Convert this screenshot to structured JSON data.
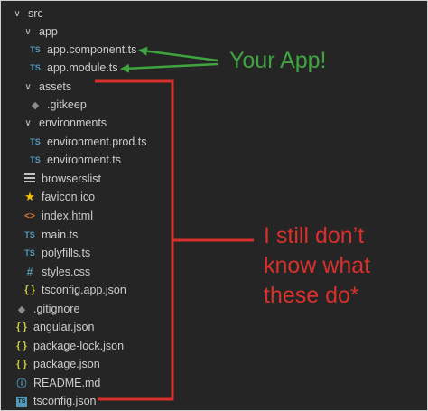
{
  "explorer": {
    "items": [
      {
        "label": "src",
        "type": "folder",
        "icon": "chevron-down"
      },
      {
        "label": "app",
        "type": "folder",
        "icon": "chevron-down"
      },
      {
        "label": "app.component.ts",
        "type": "file",
        "icon": "ts-icon"
      },
      {
        "label": "app.module.ts",
        "type": "file",
        "icon": "ts-icon"
      },
      {
        "label": "assets",
        "type": "folder",
        "icon": "chevron-down"
      },
      {
        "label": ".gitkeep",
        "type": "file",
        "icon": "gitkeep-icon"
      },
      {
        "label": "environments",
        "type": "folder",
        "icon": "chevron-down"
      },
      {
        "label": "environment.prod.ts",
        "type": "file",
        "icon": "ts-icon"
      },
      {
        "label": "environment.ts",
        "type": "file",
        "icon": "ts-icon"
      },
      {
        "label": "browserslist",
        "type": "file",
        "icon": "list-icon"
      },
      {
        "label": "favicon.ico",
        "type": "file",
        "icon": "star-icon"
      },
      {
        "label": "index.html",
        "type": "file",
        "icon": "html-icon"
      },
      {
        "label": "main.ts",
        "type": "file",
        "icon": "ts-icon"
      },
      {
        "label": "polyfills.ts",
        "type": "file",
        "icon": "ts-icon"
      },
      {
        "label": "styles.css",
        "type": "file",
        "icon": "css-icon"
      },
      {
        "label": "tsconfig.app.json",
        "type": "file",
        "icon": "json-icon"
      },
      {
        "label": ".gitignore",
        "type": "file",
        "icon": "gitignore-icon"
      },
      {
        "label": "angular.json",
        "type": "file",
        "icon": "json-icon"
      },
      {
        "label": "package-lock.json",
        "type": "file",
        "icon": "json-icon"
      },
      {
        "label": "package.json",
        "type": "file",
        "icon": "json-icon"
      },
      {
        "label": "README.md",
        "type": "file",
        "icon": "info-icon"
      },
      {
        "label": "tsconfig.json",
        "type": "file",
        "icon": "ts-box-icon"
      }
    ]
  },
  "icon_glyphs": {
    "ts": "TS",
    "json": "{ }",
    "html": "<>",
    "css": "#",
    "star": "★",
    "info": "ⓘ",
    "gitkeep": "◆",
    "chevron": "∨"
  },
  "annotations": {
    "green_text": "Your App!",
    "red_text": "I still don’t know what these do*",
    "green_color": "#3fa33f",
    "red_color": "#d8302a"
  },
  "colors": {
    "sidebar_bg": "#252526",
    "text": "#cccccc",
    "ts_blue": "#519aba",
    "json_yellow": "#cbcb41",
    "html_orange": "#e37933"
  }
}
